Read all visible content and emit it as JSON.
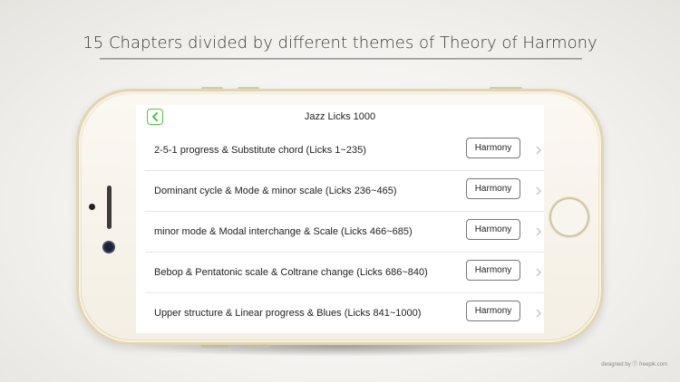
{
  "headline": "15 Chapters divided by different themes of Theory of Harmony",
  "app": {
    "title": "Jazz Licks 1000",
    "chapters": [
      {
        "label": "2-5-1 progress & Substitute chord (Licks 1~235)",
        "button": "Harmony"
      },
      {
        "label": "Dominant cycle & Mode & minor scale (Licks 236~465)",
        "button": "Harmony"
      },
      {
        "label": "minor mode & Modal interchange & Scale (Licks 466~685)",
        "button": "Harmony"
      },
      {
        "label": "Bebop & Pentatonic scale & Coltrane change (Licks 686~840)",
        "button": "Harmony"
      },
      {
        "label": "Upper structure & Linear progress & Blues (Licks 841~1000)",
        "button": "Harmony"
      }
    ]
  },
  "credit": "designed by ⓕ freepik.com",
  "colors": {
    "accent": "#53c24a"
  },
  "icons": {
    "back": "chevron-left-icon",
    "disclosure": "chevron-right-icon"
  }
}
